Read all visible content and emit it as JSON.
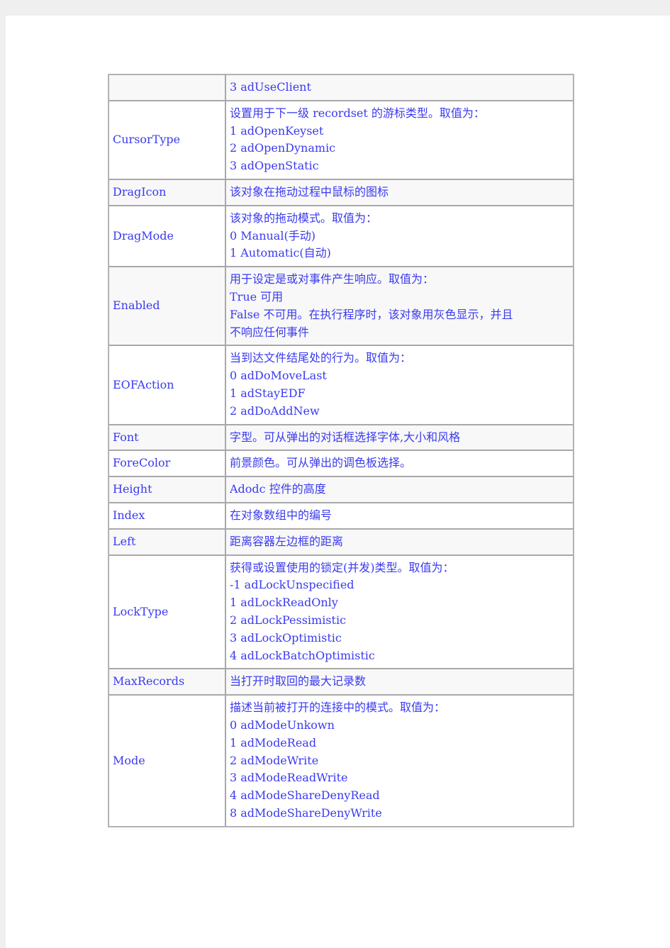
{
  "rows": [
    {
      "key": "",
      "lines": [
        "3 adUseClient"
      ],
      "shade": true
    },
    {
      "key": "CursorType",
      "lines": [
        "设置用于下一级 recordset 的游标类型。取值为：",
        "1 adOpenKeyset",
        "2 adOpenDynamic",
        "3 adOpenStatic"
      ],
      "shade": false
    },
    {
      "key": "DragIcon",
      "lines": [
        "该对象在拖动过程中鼠标的图标"
      ],
      "shade": true
    },
    {
      "key": "DragMode",
      "lines": [
        "该对象的拖动模式。取值为：",
        "0 Manual(手动)",
        "1 Automatic(自动)"
      ],
      "shade": false
    },
    {
      "key": "Enabled",
      "lines": [
        "用于设定是或对事件产生响应。取值为：",
        "True 可用",
        "False 不可用。在执行程序时，该对象用灰色显示，并且",
        "不响应任何事件"
      ],
      "shade": true
    },
    {
      "key": "EOFAction",
      "lines": [
        "当到达文件结尾处的行为。取值为：",
        "0 adDoMoveLast",
        "1 adStayEDF",
        "2 adDoAddNew"
      ],
      "shade": false
    },
    {
      "key": "Font",
      "lines": [
        "字型。可从弹出的对话框选择字体,大小和风格"
      ],
      "shade": true
    },
    {
      "key": "ForeColor",
      "lines": [
        "前景颜色。可从弹出的调色板选择。"
      ],
      "shade": false
    },
    {
      "key": "Height",
      "lines": [
        "Adodc 控件的高度"
      ],
      "shade": true
    },
    {
      "key": "Index",
      "lines": [
        "在对象数组中的编号"
      ],
      "shade": false
    },
    {
      "key": "Left",
      "lines": [
        "距离容器左边框的距离"
      ],
      "shade": true
    },
    {
      "key": "LockType",
      "lines": [
        "获得或设置使用的锁定(并发)类型。取值为：",
        "-1 adLockUnspecified",
        "1 adLockReadOnly",
        "2 adLockPessimistic",
        "3 adLockOptimistic",
        "4 adLockBatchOptimistic"
      ],
      "shade": false
    },
    {
      "key": "MaxRecords",
      "lines": [
        "当打开时取回的最大记录数"
      ],
      "shade": true
    },
    {
      "key": "Mode",
      "lines": [
        "描述当前被打开的连接中的模式。取值为：",
        "0 adModeUnkown",
        "1 adModeRead",
        "2 adModeWrite",
        "3 adModeReadWrite",
        "4 adModeShareDenyRead",
        "8 adModeShareDenyWrite"
      ],
      "shade": false
    }
  ],
  "colors": {
    "text": "#3a3af0",
    "shade": "#f8f8f8",
    "border": "#a8a8a8"
  }
}
